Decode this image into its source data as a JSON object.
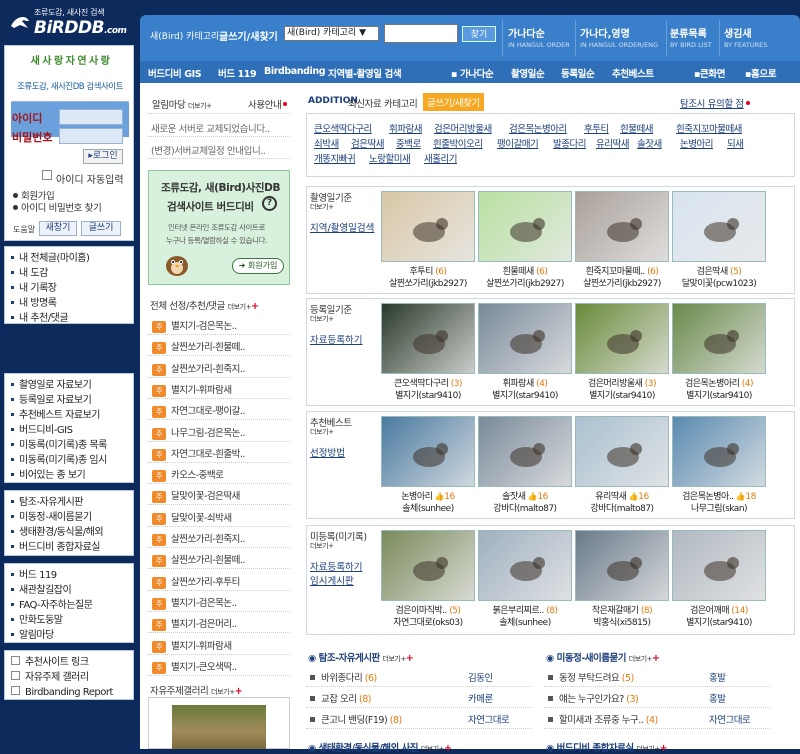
{
  "logo": {
    "tagline": "조류도감, 새사진 검색",
    "name": "BiRDDB",
    "tld": ".com"
  },
  "login": {
    "slogan": "새 사 랑 자 연 사 랑",
    "desc": "조류도감, 새사진DB 검색사이트",
    "id_label": "아이디",
    "pw_label": "비밀번호",
    "login_btn": "로그인",
    "auto_login": "아이디 자동입력",
    "signup": "회원가입",
    "find": "아이디 비밀번호 찾기",
    "dorum": "도움말",
    "new_btn": "새창기",
    "write_btn": "글쓰기"
  },
  "sidebar_my": [
    "내 전체글(마이홈)",
    "내 도감",
    "내 기록장",
    "내 방명록",
    "내 추천/댓글"
  ],
  "sidebar_menu": [
    "촬영일로 자료보기",
    "등록일로 자료보기",
    "추천베스트 자료보기",
    "버드디비-GIS",
    "미동록(미기록)종 목록",
    "미동록(미기록)종 임시",
    "비어있는 종 보기"
  ],
  "sidebar_board": [
    "탐조-자유게시판",
    "미동정-새이름묻기",
    "생태환경/동식물/해외",
    "버드디비 종합자료실"
  ],
  "sidebar_misc": [
    "버드 119",
    "새관찰길잡이",
    "FAQ-자주하는질문",
    "만화도둥말",
    "알림마당"
  ],
  "sidebar_links": [
    "추천사이트 링크",
    "자유주제 갤러리",
    "Birdbanding Report"
  ],
  "topnav": {
    "search_prefix": "새(Bird) 카테고리",
    "search_label": "글쓰기/새찾기",
    "select_value": "새(Bird) 카테고리",
    "go": "찾기",
    "col1": "가나다순",
    "col1_sub": "IN HANGUL ORDER",
    "col2": "가나다,영명",
    "col2_sub": "IN HANGUL ORDER/ENG",
    "col3": "분류목록",
    "col3_sub": "BY BIRD LIST",
    "col4": "생김새",
    "col4_sub": "BY FEATURES"
  },
  "subnav": {
    "items": [
      "버드디비 GIS",
      "버드 119",
      "Birdbanding",
      "지역별-촬영일 검색"
    ],
    "right": [
      "가나다순",
      "촬영일순",
      "등록일순",
      "추천베스트"
    ],
    "home1": "큰화면",
    "home2": "홈으로"
  },
  "notice": {
    "title": "알림마당",
    "more": "더보기+",
    "usage": "사용안내",
    "items": [
      "새로운 서버로 교체되었습니다..",
      "(변경)서버교체일정 안내입니.."
    ]
  },
  "promo": {
    "title1": "조류도감, 새(Bird)사진DB",
    "title2": "검색사이트 버드디비",
    "desc1": "인터넷 온라인 조류도감 사이트로",
    "desc2": "누구나 등록/열람하실 수 있습니다.",
    "signup": "회원가입"
  },
  "recommend": {
    "title": "전체 선정/추천/댓글",
    "more": "더보기+",
    "badge": "주",
    "items": [
      "별지기-검은목논..",
      "살찐쏘가리-흰물떼..",
      "살찐쏘가리-흰죽지..",
      "별지기-휘파람새",
      "자연그대로-팽이갈..",
      "나무그림-검은목논..",
      "자연그대로-흰줄박..",
      "카오스-중백로",
      "달맞이꽃-검은딱새",
      "달맞이꽃-쇠박새",
      "살찐쏘가리-흰죽지..",
      "살찐쏘가리-흰물떼..",
      "살찐쏘가리-후투티",
      "별지기-검은목논..",
      "별지기-검은머리..",
      "별지기-휘파람새",
      "별지기-큰오색딱.."
    ]
  },
  "gallery": {
    "title": "자유주제갤러리",
    "more": "더보기+"
  },
  "addition": {
    "label": "ADDITION",
    "desc": "최신자료 카테고리",
    "badge": "글쓰기/새찾기",
    "notice": "탐조시 유의할 점",
    "tags_row1": [
      "큰오색딱다구리",
      "휘파람새",
      "검은머리방울새",
      "검은목논병아리",
      "후투티",
      "흰물떼새",
      "흰죽지꼬마물떼새"
    ],
    "tags_row2": [
      "쇠박새",
      "검은딱새",
      "중백로",
      "흰줄박이오리",
      "팽이갈매기",
      "발종다리",
      "유리딱새",
      "솔잣새",
      "논병아리",
      "되새"
    ],
    "tags_row3": [
      "개똥지빠귀",
      "노랑할미새",
      "새홀리기"
    ]
  },
  "sections": [
    {
      "label": "촬영일기준",
      "more": "더보기+",
      "link": "지역/촬영일검색",
      "items": [
        {
          "name": "후투티",
          "count": "(6)",
          "user": "살찐쏘가리(jkb2927)"
        },
        {
          "name": "흰물떼새",
          "count": "(6)",
          "user": "살찐쏘가리(jkb2927)"
        },
        {
          "name": "흰죽지꼬마물떼..",
          "count": "(6)",
          "user": "살찐쏘가리(jkb2927)"
        },
        {
          "name": "검은딱새",
          "count": "(5)",
          "user": "달맞이꽃(pcw1023)"
        }
      ]
    },
    {
      "label": "등록일기준",
      "more": "더보기+",
      "link": "자료등록하기",
      "items": [
        {
          "name": "큰오색딱다구리",
          "count": "(3)",
          "user": "별지기(star9410)"
        },
        {
          "name": "휘파람새",
          "count": "(4)",
          "user": "별지기(star9410)"
        },
        {
          "name": "검은머리방울새",
          "count": "(3)",
          "user": "별지기(star9410)"
        },
        {
          "name": "검은목논병아리",
          "count": "(4)",
          "user": "별지기(star9410)"
        }
      ]
    },
    {
      "label": "추천베스트",
      "more": "더보기+",
      "link": "선정방법",
      "items": [
        {
          "name": "논병아리",
          "count": "16",
          "user": "솔체(sunhee)"
        },
        {
          "name": "솔잣새",
          "count": "16",
          "user": "강바다(malto87)"
        },
        {
          "name": "유리딱새",
          "count": "16",
          "user": "강바다(malto87)"
        },
        {
          "name": "검은목논병아..",
          "count": "18",
          "user": "나무그림(skan)"
        }
      ]
    },
    {
      "label": "미등록(미기록)",
      "more": "더보기+",
      "link": "자료등록하기",
      "link2": "임시게시판",
      "items": [
        {
          "name": "검은이마직박..",
          "count": "(5)",
          "user": "자연그대로(oks03)"
        },
        {
          "name": "붉은부리찌르..",
          "count": "(8)",
          "user": "솔체(sunhee)"
        },
        {
          "name": "작은재갈매기",
          "count": "(8)",
          "user": "박홍식(xi5815)"
        },
        {
          "name": "검은어깨매",
          "count": "(14)",
          "user": "별지기(star9410)"
        }
      ]
    }
  ],
  "board_left": {
    "title": "탐조-자유게시판",
    "more": "더보기+",
    "rows": [
      {
        "title": "바위종다리",
        "count": "(6)",
        "user": "김동인"
      },
      {
        "title": "교잡 오리",
        "count": "(8)",
        "user": "카메룬"
      },
      {
        "title": "큰고니 밴딩(F19)",
        "count": "(8)",
        "user": "자연그대로"
      }
    ]
  },
  "board_right": {
    "title": "미동정-새이름묻기",
    "more": "더보기+",
    "rows": [
      {
        "title": "동정 부탁드려요",
        "count": "(5)",
        "user": "홍발"
      },
      {
        "title": "얘는 누구인가요?",
        "count": "(3)",
        "user": "홍발"
      },
      {
        "title": "할미새과 조류중 누구..",
        "count": "(4)",
        "user": "자연그대로"
      }
    ]
  },
  "board_bottom_left": {
    "title": "생태환경/동식물/해외 사진",
    "more": "더보기+"
  },
  "board_bottom_right": {
    "title": "버드디비 종합자료실",
    "more": "더보기+"
  }
}
